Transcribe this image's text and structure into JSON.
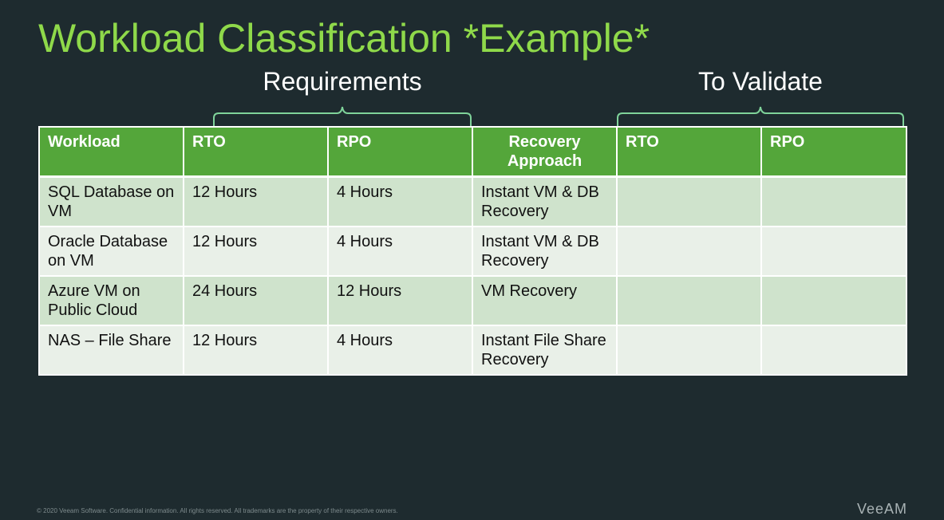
{
  "title": "Workload Classification *Example*",
  "groups": {
    "requirements": "Requirements",
    "to_validate": "To Validate"
  },
  "table": {
    "headers": [
      "Workload",
      "RTO",
      "RPO",
      "Recovery Approach",
      "RTO",
      "RPO"
    ],
    "rows": [
      [
        "SQL Database on VM",
        "12 Hours",
        "4 Hours",
        "Instant VM & DB Recovery",
        "",
        ""
      ],
      [
        "Oracle Database on VM",
        "12 Hours",
        "4 Hours",
        "Instant VM & DB Recovery",
        "",
        ""
      ],
      [
        "Azure VM on Public Cloud",
        "24 Hours",
        "12 Hours",
        "VM Recovery",
        "",
        ""
      ],
      [
        "NAS – File Share",
        "12 Hours",
        "4 Hours",
        "Instant File Share Recovery",
        "",
        ""
      ]
    ]
  },
  "footer": "© 2020 Veeam Software. Confidential information. All rights reserved. All trademarks are the property of their respective owners.",
  "logo": "VeeAM",
  "colors": {
    "background": "#1e2b2f",
    "title": "#8fd94a",
    "header": "#54a63a",
    "row_odd": "#cfe3cc",
    "row_even": "#e9f0e8",
    "bracket": "#7fd39a"
  }
}
